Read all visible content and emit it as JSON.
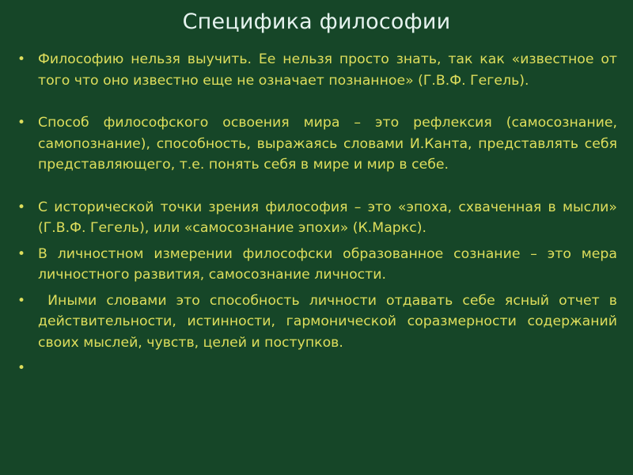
{
  "slide": {
    "title": "Специфика философии",
    "bullet_glyph": "•",
    "items": [
      {
        "text": "Философию нельзя выучить. Ее нельзя просто знать, так как «известное от того что оно известно еще не означает познанное» (Г.В.Ф. Гегель)."
      },
      {
        "text": "Способ философского освоения мира – это рефлексия (самосознание, самопознание), способность, выражаясь словами И.Канта, представлять себя представляющего, т.е. понять себя в мире и мир в себе."
      },
      {
        "text": "С исторической точки зрения философия – это «эпоха, схваченная в мысли» (Г.В.Ф. Гегель), или «самосознание эпохи» (К.Маркс)."
      },
      {
        "text": "В личностном измерении философски образованное сознание – это мера личностного развития, самосознание личности."
      },
      {
        "text": " Иными словами это способность личности отдавать себе ясный отчет в действительности, истинности, гармонической соразмерности содержаний своих мыслей, чувств, целей и поступков."
      },
      {
        "text": ""
      }
    ]
  },
  "colors": {
    "background": "#164628",
    "title": "#e6f3ef",
    "body_text": "#dede5c"
  }
}
